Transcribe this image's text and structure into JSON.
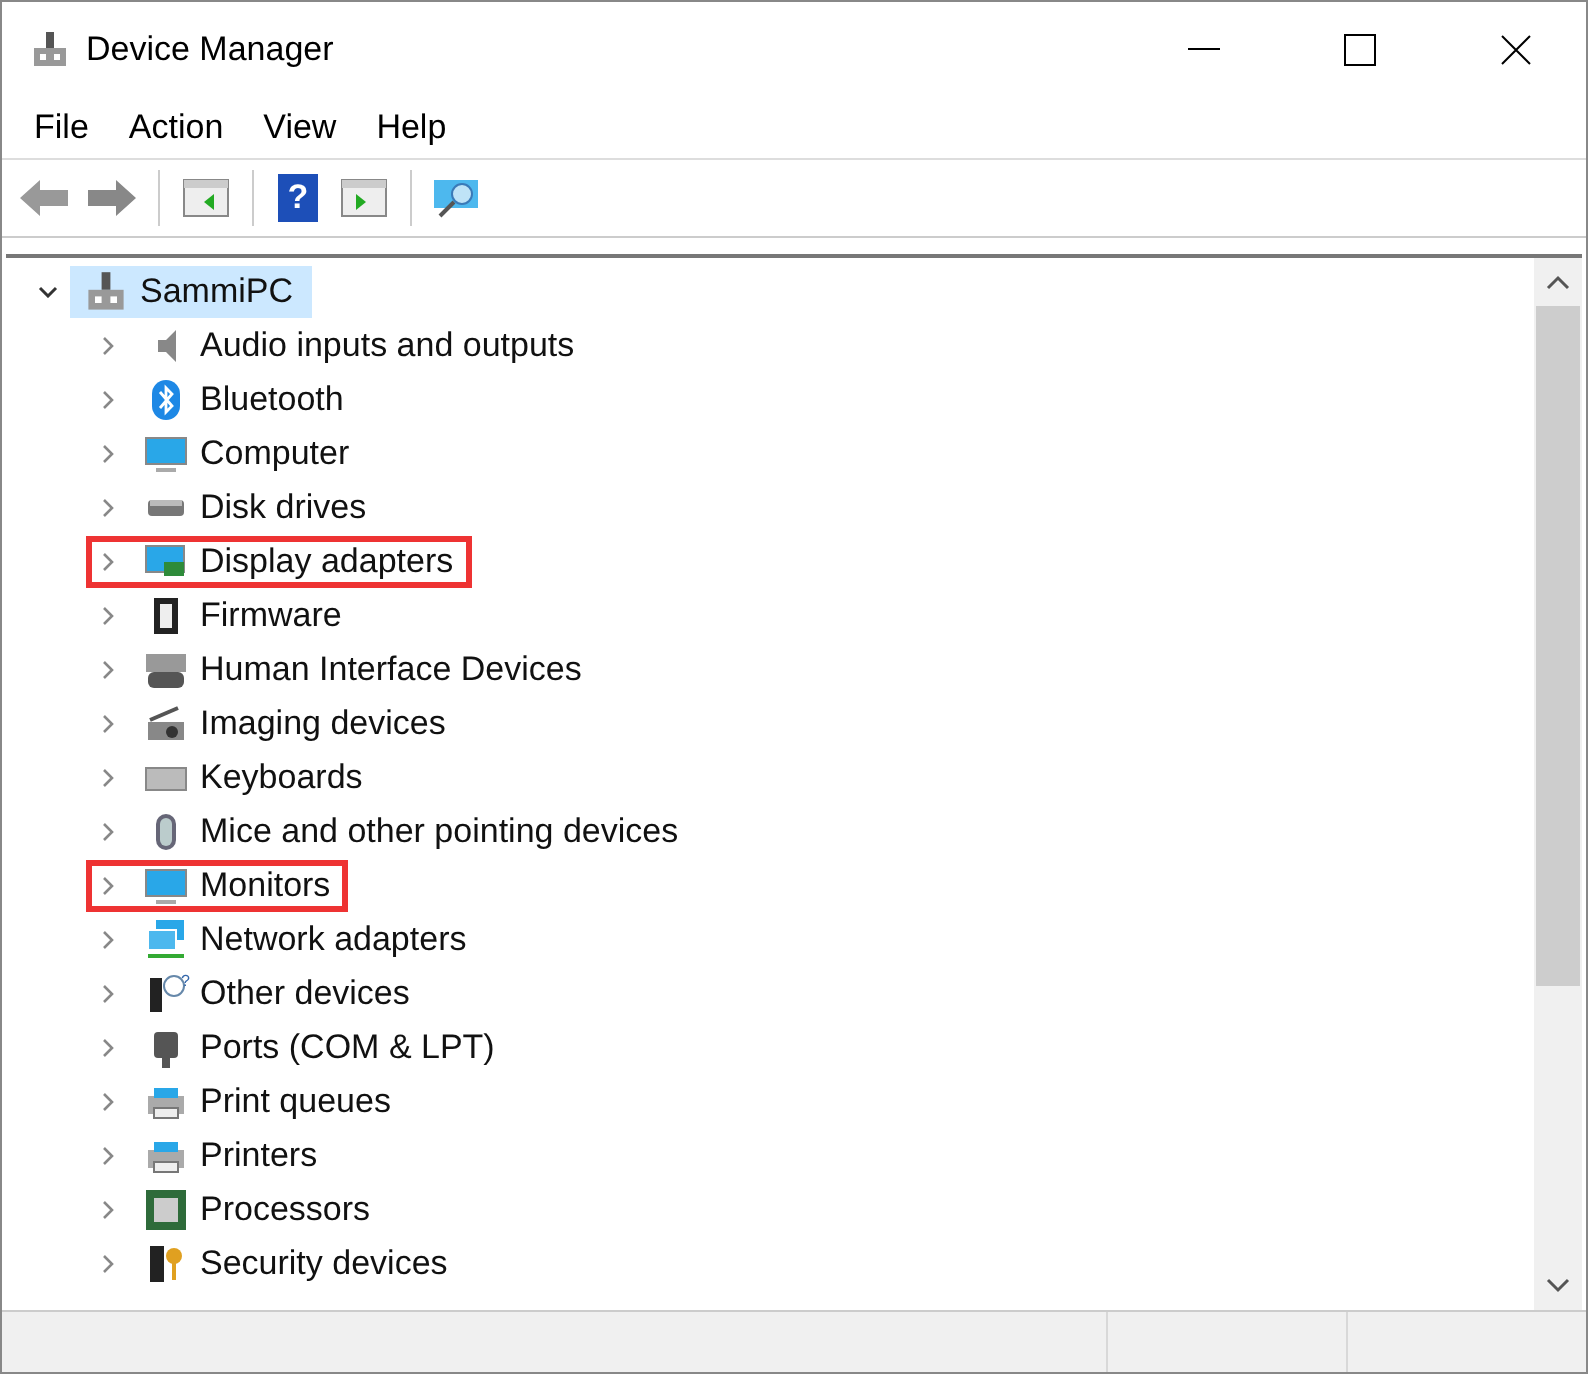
{
  "window": {
    "title": "Device Manager"
  },
  "menu": [
    "File",
    "Action",
    "View",
    "Help"
  ],
  "toolbar": {
    "help_glyph": "?"
  },
  "tree": {
    "label": "SammiPC",
    "expanded": true,
    "selected": true,
    "children": [
      {
        "label": "Audio inputs and outputs",
        "expanded": false,
        "highlighted": false
      },
      {
        "label": "Bluetooth",
        "expanded": false,
        "highlighted": false
      },
      {
        "label": "Computer",
        "expanded": false,
        "highlighted": false
      },
      {
        "label": "Disk drives",
        "expanded": false,
        "highlighted": false
      },
      {
        "label": "Display adapters",
        "expanded": false,
        "highlighted": true
      },
      {
        "label": "Firmware",
        "expanded": false,
        "highlighted": false
      },
      {
        "label": "Human Interface Devices",
        "expanded": false,
        "highlighted": false
      },
      {
        "label": "Imaging devices",
        "expanded": false,
        "highlighted": false
      },
      {
        "label": "Keyboards",
        "expanded": false,
        "highlighted": false
      },
      {
        "label": "Mice and other pointing devices",
        "expanded": false,
        "highlighted": false
      },
      {
        "label": "Monitors",
        "expanded": false,
        "highlighted": true
      },
      {
        "label": "Network adapters",
        "expanded": false,
        "highlighted": false
      },
      {
        "label": "Other devices",
        "expanded": false,
        "highlighted": false,
        "badge": "?"
      },
      {
        "label": "Ports (COM & LPT)",
        "expanded": false,
        "highlighted": false
      },
      {
        "label": "Print queues",
        "expanded": false,
        "highlighted": false
      },
      {
        "label": "Printers",
        "expanded": false,
        "highlighted": false
      },
      {
        "label": "Processors",
        "expanded": false,
        "highlighted": false
      },
      {
        "label": "Security devices",
        "expanded": false,
        "highlighted": false
      }
    ]
  }
}
